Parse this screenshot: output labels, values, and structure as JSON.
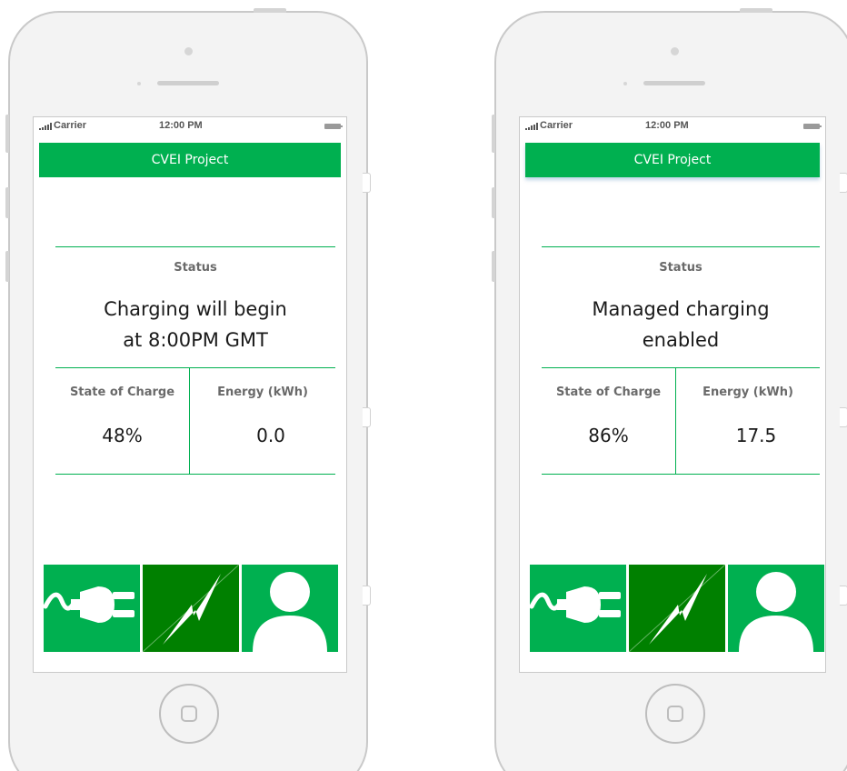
{
  "colors": {
    "brand_green": "#00b050",
    "active_tab_green": "#008000",
    "divider_green": "#00b050"
  },
  "screens": [
    {
      "statusbar": {
        "carrier": "Carrier",
        "time": "12:00 PM"
      },
      "header_title": "CVEI Project",
      "status_label": "Status",
      "status_message": "Charging will begin\nat 8:00PM GMT",
      "soc_label": "State of Charge",
      "soc_value": "48%",
      "energy_label": "Energy (kWh)",
      "energy_value": "0.0",
      "tabs": [
        {
          "icon": "plug-icon",
          "active": false
        },
        {
          "icon": "lightning-icon",
          "active": true
        },
        {
          "icon": "user-icon",
          "active": false
        }
      ]
    },
    {
      "statusbar": {
        "carrier": "Carrier",
        "time": "12:00 PM"
      },
      "header_title": "CVEI Project",
      "status_label": "Status",
      "status_message": "Managed charging\nenabled",
      "soc_label": "State of Charge",
      "soc_value": "86%",
      "energy_label": "Energy (kWh)",
      "energy_value": "17.5",
      "tabs": [
        {
          "icon": "plug-icon",
          "active": false
        },
        {
          "icon": "lightning-icon",
          "active": true
        },
        {
          "icon": "user-icon",
          "active": false
        }
      ]
    }
  ]
}
